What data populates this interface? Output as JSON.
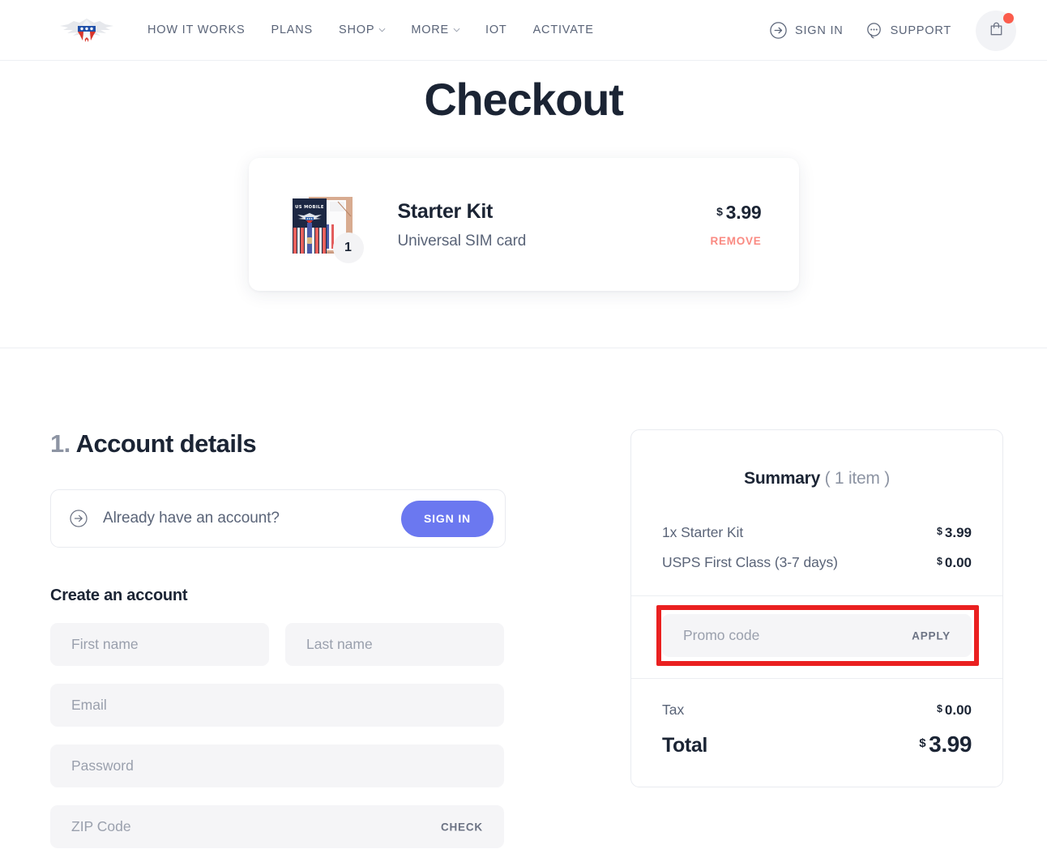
{
  "header": {
    "logo_alt": "US Mobile eagle logo",
    "nav_items": [
      {
        "label": "HOW IT WORKS",
        "has_dropdown": false
      },
      {
        "label": "PLANS",
        "has_dropdown": false
      },
      {
        "label": "SHOP",
        "has_dropdown": true
      },
      {
        "label": "MORE",
        "has_dropdown": true
      },
      {
        "label": "IOT",
        "has_dropdown": false
      },
      {
        "label": "ACTIVATE",
        "has_dropdown": false
      }
    ],
    "sign_in": "SIGN IN",
    "support": "SUPPORT",
    "cart_has_notification": true
  },
  "page": {
    "title": "Checkout"
  },
  "product": {
    "name": "Starter Kit",
    "description": "Universal SIM card",
    "price_currency": "$",
    "price_amount": "3.99",
    "quantity": "1",
    "remove_label": "REMOVE",
    "card_brand_text": "US MOBILE"
  },
  "account": {
    "step_number": "1.",
    "heading": "Account details",
    "existing_prompt": "Already have an account?",
    "sign_in_button": "SIGN IN",
    "create_heading": "Create an account",
    "fields": {
      "first_name": {
        "placeholder": "First name",
        "value": ""
      },
      "last_name": {
        "placeholder": "Last name",
        "value": ""
      },
      "email": {
        "placeholder": "Email",
        "value": ""
      },
      "password": {
        "placeholder": "Password",
        "value": ""
      },
      "zip": {
        "placeholder": "ZIP Code",
        "value": "",
        "action_label": "CHECK"
      }
    }
  },
  "summary": {
    "title": "Summary",
    "items_count": "( 1 item )",
    "lines": [
      {
        "label": "1x Starter Kit",
        "currency": "$",
        "amount": "3.99"
      },
      {
        "label": "USPS First Class (3-7 days)",
        "currency": "$",
        "amount": "0.00"
      }
    ],
    "promo": {
      "placeholder": "Promo code",
      "value": "",
      "apply_label": "APPLY",
      "highlighted": true
    },
    "tax": {
      "label": "Tax",
      "currency": "$",
      "amount": "0.00"
    },
    "total": {
      "label": "Total",
      "currency": "$",
      "amount": "3.99"
    }
  },
  "colors": {
    "accent_indigo": "#6b78f0",
    "dark_navy": "#1b2434",
    "muted_text": "#5a6478",
    "remove_coral": "#fa8a82",
    "cart_dot": "#fb5c4c",
    "highlight_red": "#ea2020",
    "field_bg": "#f5f5f7"
  }
}
